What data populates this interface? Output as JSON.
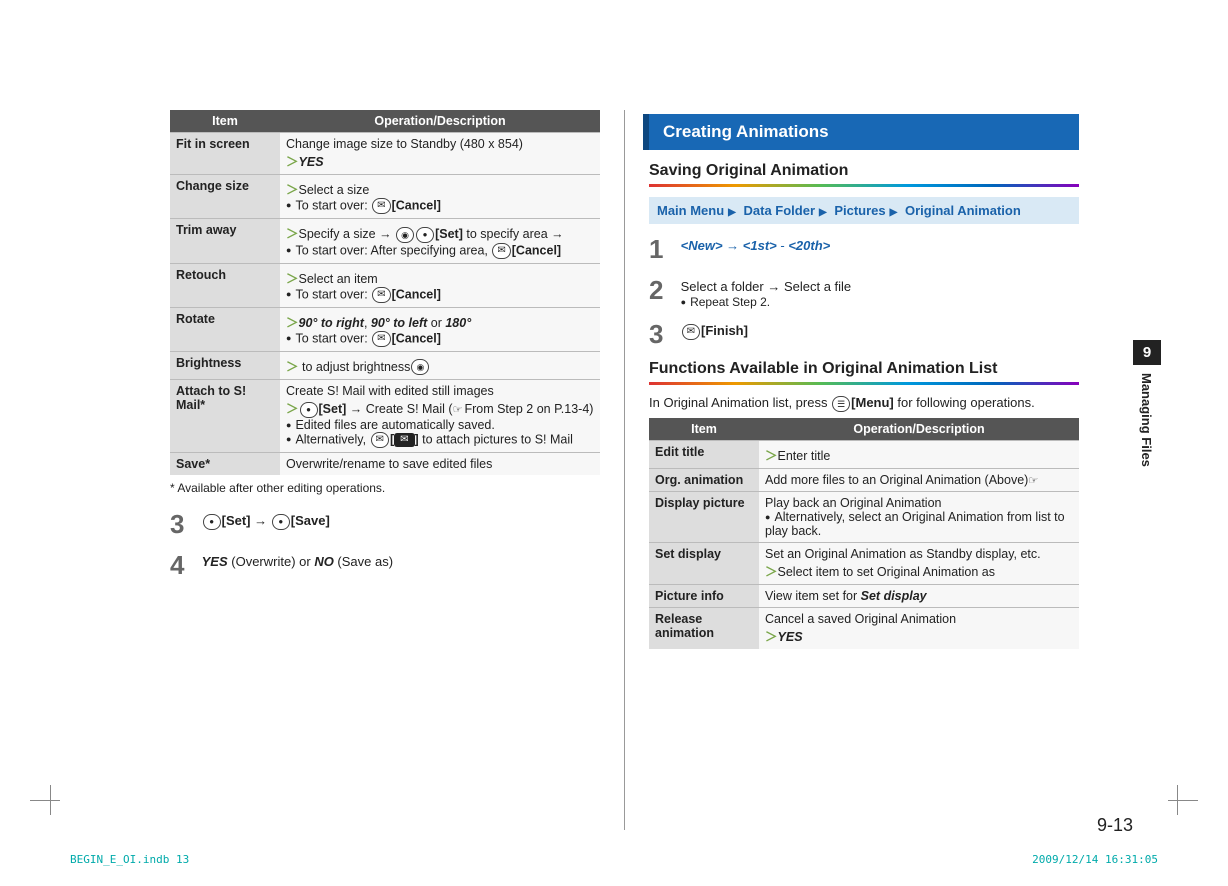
{
  "left": {
    "table_headers": [
      "Item",
      "Operation/Description"
    ],
    "rows": [
      {
        "item": "Fit in screen",
        "lines": [
          {
            "t": "Change image size to Standby (480 x 854)"
          },
          {
            "chev": true,
            "boldit": "YES"
          }
        ]
      },
      {
        "item": "Change size",
        "lines": [
          {
            "chev": true,
            "t": "Select a size"
          },
          {
            "bullet": true,
            "t": "To start over: ",
            "mailkey": true,
            "bold": "[Cancel]"
          }
        ]
      },
      {
        "item": "Trim away",
        "lines": [
          {
            "chev": true,
            "t": "Specify a size → ",
            "navkey": true,
            "t2": " to specify area → ",
            "centerkey": true,
            "bold": "[Set]"
          },
          {
            "bullet": true,
            "t": "To start over: After specifying area, ",
            "mailkey": true,
            "bold": "[Cancel]"
          }
        ]
      },
      {
        "item": "Retouch",
        "lines": [
          {
            "chev": true,
            "t": "Select an item"
          },
          {
            "bullet": true,
            "t": "To start over: ",
            "mailkey": true,
            "bold": "[Cancel]"
          }
        ]
      },
      {
        "item": "Rotate",
        "lines": [
          {
            "chev": true,
            "boldit": "90° to right",
            "mid": ", ",
            "boldit2": "90° to left",
            "mid2": " or ",
            "boldit3": "180°"
          },
          {
            "bullet": true,
            "t": "To start over: ",
            "mailkey": true,
            "bold": "[Cancel]"
          }
        ]
      },
      {
        "item": "Brightness",
        "lines": [
          {
            "chev": true,
            "navkey": true,
            "t": " to adjust brightness"
          }
        ]
      },
      {
        "item": "Attach to S! Mail*",
        "lines": [
          {
            "t": "Create S! Mail with edited still images"
          },
          {
            "chev": true,
            "centerkey": true,
            "bold": "[Set]",
            "t2": " → Create S! Mail (",
            "hand": true,
            "t3": "From Step 2 on P.13-4)"
          },
          {
            "bullet": true,
            "t": "Edited files are automatically saved."
          },
          {
            "bullet": true,
            "t": "Alternatively, ",
            "mailkey": true,
            "bold": "[",
            "blackmail": true,
            "bold2": "]",
            "t2": " to attach pictures to S! Mail"
          }
        ]
      },
      {
        "item": "Save*",
        "lines": [
          {
            "t": "Overwrite/rename to save edited files"
          }
        ]
      }
    ],
    "footnote": "* Available after other editing operations.",
    "step3": {
      "num": "3",
      "set": "[Set]",
      "arrow": " → ",
      "save": "[Save]"
    },
    "step4": {
      "num": "4",
      "yes": "YES",
      "ow": " (Overwrite) or ",
      "no": "NO",
      "sa": " (Save as)"
    }
  },
  "right": {
    "section": "Creating Animations",
    "sub1": "Saving Original Animation",
    "menubar": [
      "Main Menu",
      "Data Folder",
      "Pictures",
      "Original Animation"
    ],
    "step1": {
      "num": "1",
      "new": "<New>",
      "arr": " → ",
      "first": "<1st>",
      "dash": " - ",
      "last": "<20th>"
    },
    "step2": {
      "num": "2",
      "t": "Select a folder → Select a file",
      "b": "Repeat Step 2."
    },
    "step3": {
      "num": "3",
      "finish": "[Finish]"
    },
    "sub2": "Functions Available in Original Animation List",
    "intro_pre": "In Original Animation list, press ",
    "intro_bold": "[Menu]",
    "intro_post": " for following operations.",
    "table_headers": [
      "Item",
      "Operation/Description"
    ],
    "rows": [
      {
        "item": "Edit title",
        "lines": [
          {
            "chev": true,
            "t": "Enter title"
          }
        ]
      },
      {
        "item": "Org. animation",
        "lines": [
          {
            "t": "Add more files to an Original Animation (",
            "hand": true,
            "t2": "Above)"
          }
        ]
      },
      {
        "item": "Display picture",
        "lines": [
          {
            "t": "Play back an Original Animation"
          },
          {
            "bullet": true,
            "t": "Alternatively, select an Original Animation from list to play back."
          }
        ]
      },
      {
        "item": "Set display",
        "lines": [
          {
            "t": "Set an Original Animation as Standby display, etc."
          },
          {
            "chev": true,
            "t": "Select item to set Original Animation as"
          }
        ]
      },
      {
        "item": "Picture info",
        "lines": [
          {
            "t": "View item set for ",
            "boldit": "Set display"
          }
        ]
      },
      {
        "item": "Release animation",
        "lines": [
          {
            "t": "Cancel a saved Original Animation"
          },
          {
            "chev": true,
            "boldit": "YES"
          }
        ]
      }
    ]
  },
  "sidebar": {
    "num": "9",
    "label": "Managing Files"
  },
  "pagenum": "9-13",
  "footer_left": "BEGIN_E_OI.indb   13",
  "footer_right": "2009/12/14   16:31:05"
}
